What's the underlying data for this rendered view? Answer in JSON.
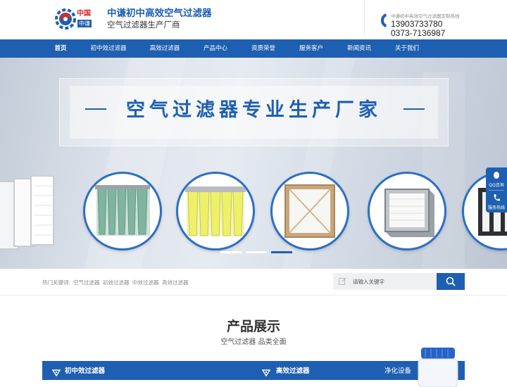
{
  "header": {
    "title": "中谦初中高效空气过滤器",
    "subtitle": "空气过滤器生产厂商",
    "logo_text": [
      "中国",
      "中谦"
    ],
    "hotline_label": "中谦初中高效空气过滤器定制热线",
    "phones": [
      "13903733780",
      "0373-7136987"
    ]
  },
  "nav": {
    "items": [
      "首页",
      "初中效过滤器",
      "高效过滤器",
      "产品中心",
      "资质荣誉",
      "服务客户",
      "新闻资讯",
      "关于我们"
    ],
    "active_index": 0
  },
  "banner": {
    "slogan": "空气过滤器专业生产厂家",
    "slide_count": 3,
    "active_slide": 2
  },
  "side_float": {
    "items": [
      {
        "label": "QQ咨询",
        "icon": "qq-penguin-icon"
      },
      {
        "label": "服务热线",
        "icon": "phone-icon"
      }
    ]
  },
  "search": {
    "hot_label": "热门关键词:",
    "keywords": [
      "空气过滤器",
      "初效过滤器",
      "中效过滤器",
      "高效过滤器"
    ],
    "placeholder": "请输入关键字"
  },
  "products": {
    "title": "产品展示",
    "subtitle": "空气过滤器 品类全面",
    "categories": [
      "初中效过滤器",
      "高效过滤器",
      "净化设备"
    ]
  },
  "colors": {
    "brand_blue": "#1f5fb1",
    "title_blue": "#1e5fb3",
    "logo_red": "#d42b2b"
  }
}
